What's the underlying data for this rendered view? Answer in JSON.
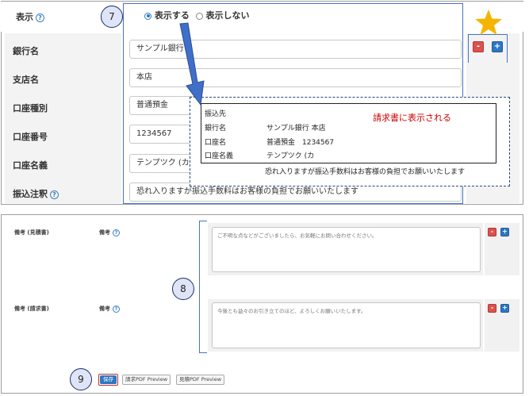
{
  "top": {
    "display_label": "表示",
    "callout_7": "7",
    "radio_show": "表示する",
    "radio_hide": "表示しない",
    "fields": [
      {
        "label": "銀行名",
        "value": "サンプル銀行"
      },
      {
        "label": "支店名",
        "value": "本店"
      },
      {
        "label": "口座種別",
        "value": "普通預金"
      },
      {
        "label": "口座番号",
        "value": "1234567"
      },
      {
        "label": "口座名義",
        "value": "テンプツク (カ"
      },
      {
        "label": "振込注釈",
        "value": "恐れ入りますが振込手数料はお客様の負担でお願いいたします"
      }
    ],
    "minus": "-",
    "plus": "+",
    "preview": {
      "heading": "振込先",
      "note": "請求書に表示される",
      "rows": [
        {
          "k": "銀行名",
          "v": "サンプル銀行 本店"
        },
        {
          "k": "口座名",
          "v": "普通預金　1234567"
        },
        {
          "k": "口座名義",
          "v": "テンプツク (カ"
        }
      ],
      "footer": "恐れ入りますが振込手数料はお客様の負担でお願いいたします"
    },
    "colors": {
      "star": "#f5b400",
      "arrow": "#3f6fc9",
      "dashed": "#2c4a7a",
      "note": "#cc0000"
    }
  },
  "bottom": {
    "callout_8": "8",
    "callout_9": "9",
    "rows": [
      {
        "label": "備考 (見積書)",
        "sub_label": "備考",
        "text": "ご不明な点などがございましたら、お気軽にお問い合わせください。"
      },
      {
        "label": "備考 (請求書)",
        "sub_label": "備考",
        "text": "今後とも益々のお引き立てのほど、よろしくお願いいたします。"
      }
    ],
    "save": "保存",
    "invoice_preview": "請求PDF Preview",
    "estimate_preview": "見積PDF Preview"
  }
}
